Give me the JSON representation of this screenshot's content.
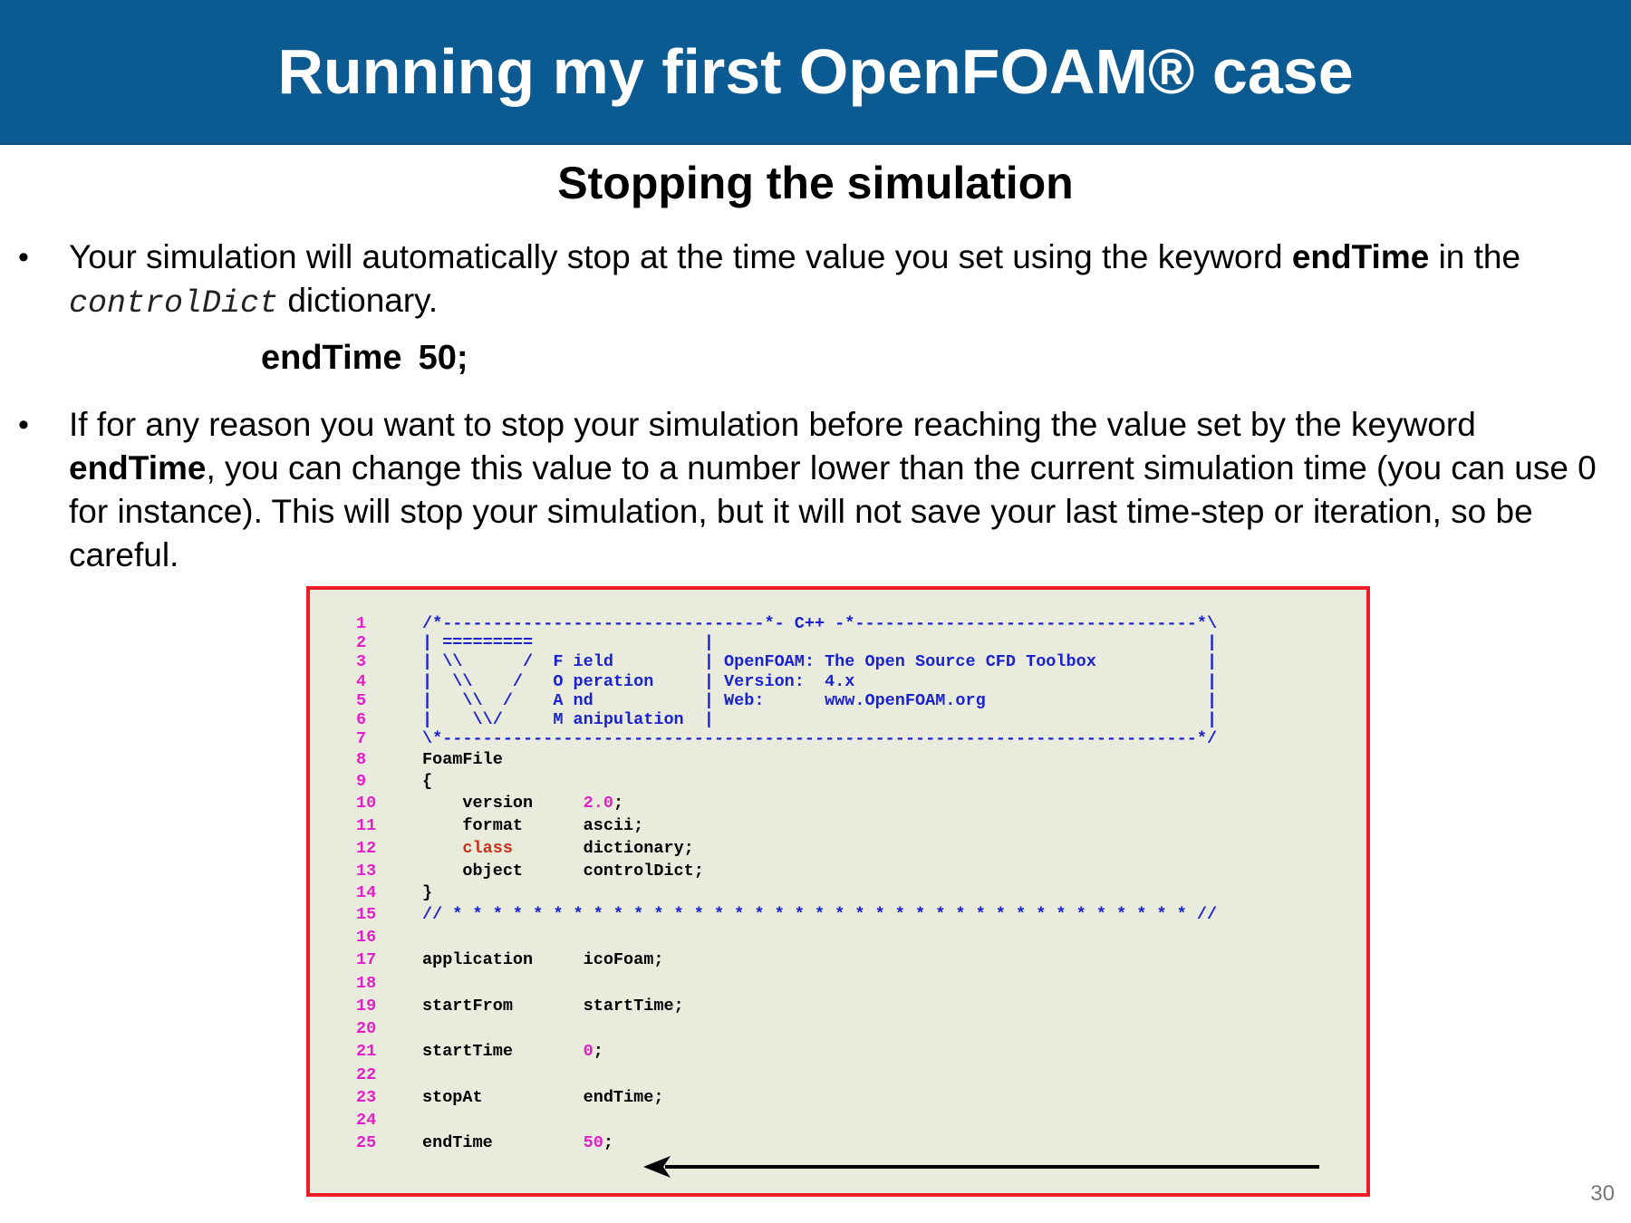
{
  "header": {
    "title": "Running my first OpenFOAM® case"
  },
  "subtitle": "Stopping the simulation",
  "bullets": [
    {
      "bullet_char": "•",
      "part1": "Your simulation will automatically stop at the time value you set using the keyword ",
      "bold": "endTime",
      "part2": " in the ",
      "mono": "controlDict",
      "part3": " dictionary."
    },
    {
      "bullet_char": "•",
      "part1": "If for any reason you want to stop your simulation before reaching the value set by the keyword ",
      "bold": "endTime",
      "part2": ", you can change this value to a number lower than the current simulation time (you can use 0 for instance).  This will stop your simulation, but it will not save your last time-step or iteration, so be careful."
    }
  ],
  "endtime_example": {
    "keyword": "endTime",
    "value": "50;"
  },
  "code": {
    "lines": [
      {
        "n": "1",
        "segs": [
          {
            "t": "/*--------------------------------*- C++ -*----------------------------------*\\",
            "c": "blue"
          }
        ]
      },
      {
        "n": "2",
        "segs": [
          {
            "t": "| =========                 |                                                 |",
            "c": "blue"
          }
        ]
      },
      {
        "n": "3",
        "segs": [
          {
            "t": "| \\\\      /  F ield         | OpenFOAM: The Open Source CFD Toolbox           |",
            "c": "blue"
          }
        ]
      },
      {
        "n": "4",
        "segs": [
          {
            "t": "|  \\\\    /   O peration     | Version:  4.x                                   |",
            "c": "blue"
          }
        ]
      },
      {
        "n": "5",
        "segs": [
          {
            "t": "|   \\\\  /    A nd           | Web:      www.OpenFOAM.org                      |",
            "c": "blue"
          }
        ]
      },
      {
        "n": "6",
        "segs": [
          {
            "t": "|    \\\\/     M anipulation  |                                                 |",
            "c": "blue"
          }
        ]
      },
      {
        "n": "7",
        "segs": [
          {
            "t": "\\*---------------------------------------------------------------------------*/",
            "c": "blue"
          }
        ]
      },
      {
        "n": "8",
        "segs": [
          {
            "t": "FoamFile",
            "c": "black"
          }
        ]
      },
      {
        "n": "9",
        "segs": [
          {
            "t": "{",
            "c": "black"
          }
        ]
      },
      {
        "n": "10",
        "segs": [
          {
            "t": "    version     ",
            "c": "black"
          },
          {
            "t": "2.0",
            "c": "mag"
          },
          {
            "t": ";",
            "c": "black"
          }
        ]
      },
      {
        "n": "11",
        "segs": [
          {
            "t": "    format      ascii;",
            "c": "black"
          }
        ]
      },
      {
        "n": "12",
        "segs": [
          {
            "t": "    ",
            "c": "black"
          },
          {
            "t": "class",
            "c": "red"
          },
          {
            "t": "       dictionary;",
            "c": "black"
          }
        ]
      },
      {
        "n": "13",
        "segs": [
          {
            "t": "    object      controlDict;",
            "c": "black"
          }
        ]
      },
      {
        "n": "14",
        "segs": [
          {
            "t": "}",
            "c": "black"
          }
        ]
      },
      {
        "n": "15",
        "segs": [
          {
            "t": "// * * * * * * * * * * * * * * * * * * * * * * * * * * * * * * * * * * * * * //",
            "c": "blue"
          }
        ]
      },
      {
        "n": "16",
        "segs": [
          {
            "t": "",
            "c": "black"
          }
        ]
      },
      {
        "n": "17",
        "segs": [
          {
            "t": "application     icoFoam;",
            "c": "black"
          }
        ]
      },
      {
        "n": "18",
        "segs": [
          {
            "t": "",
            "c": "black"
          }
        ]
      },
      {
        "n": "19",
        "segs": [
          {
            "t": "startFrom       startTime;",
            "c": "black"
          }
        ]
      },
      {
        "n": "20",
        "segs": [
          {
            "t": "",
            "c": "black"
          }
        ]
      },
      {
        "n": "21",
        "segs": [
          {
            "t": "startTime       ",
            "c": "black"
          },
          {
            "t": "0",
            "c": "mag"
          },
          {
            "t": ";",
            "c": "black"
          }
        ]
      },
      {
        "n": "22",
        "segs": [
          {
            "t": "",
            "c": "black"
          }
        ]
      },
      {
        "n": "23",
        "segs": [
          {
            "t": "stopAt          endTime;",
            "c": "black"
          }
        ]
      },
      {
        "n": "24",
        "segs": [
          {
            "t": "",
            "c": "black"
          }
        ]
      },
      {
        "n": "25",
        "segs": [
          {
            "t": "endTime         ",
            "c": "black"
          },
          {
            "t": "50",
            "c": "mag"
          },
          {
            "t": ";",
            "c": "black"
          }
        ]
      }
    ]
  },
  "page_number": "30",
  "colors": {
    "header_bg": "#0b5a92",
    "code_bg": "#e9ecdc",
    "code_border": "#ee1c24",
    "line_number": "#e020c8",
    "comment": "#1a22d0"
  }
}
